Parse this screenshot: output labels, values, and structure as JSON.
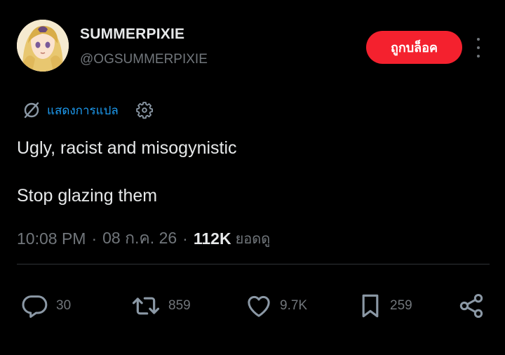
{
  "author": {
    "display_name": "SUMMERPIXIE",
    "handle": "@OGSUMMERPIXIE"
  },
  "header": {
    "blocked_label": "ถูกบล็อค",
    "more_icon": "more-vertical-icon"
  },
  "translate": {
    "label": "แสดงการแปล",
    "icon": "translate-icon",
    "settings_icon": "gear-icon"
  },
  "tweet": {
    "lines": [
      "Ugly, racist and misogynistic",
      "Stop glazing them"
    ]
  },
  "meta": {
    "time": "10:08 PM",
    "separator": "·",
    "date": "08 ก.ค. 26",
    "views_count": "112K",
    "views_label": "ยอดดู"
  },
  "actions": {
    "reply": {
      "icon": "reply-icon",
      "count": "30"
    },
    "repost": {
      "icon": "repost-icon",
      "count": "859"
    },
    "like": {
      "icon": "heart-icon",
      "count": "9.7K"
    },
    "bookmark": {
      "icon": "bookmark-icon",
      "count": "259"
    },
    "share": {
      "icon": "share-icon"
    }
  },
  "colors": {
    "background": "#000000",
    "text": "#e7e9ea",
    "muted": "#71767b",
    "accent": "#1d9bf0",
    "danger": "#f4212e"
  }
}
